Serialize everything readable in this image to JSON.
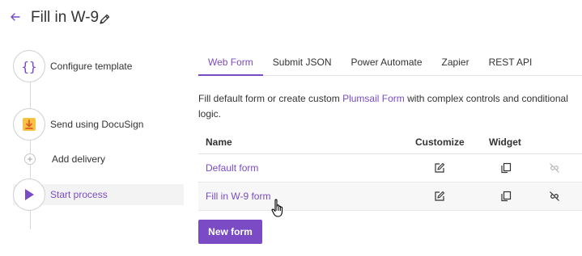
{
  "header": {
    "back_icon": "arrow-left-icon",
    "title": "Fill in W-9",
    "edit_icon": "pencil-icon"
  },
  "steps": [
    {
      "label": "Configure template",
      "icon": "braces-icon"
    },
    {
      "label": "Send using DocuSign",
      "icon": "download-icon"
    },
    {
      "label": "Add delivery",
      "icon": "plus-icon"
    },
    {
      "label": "Start process",
      "icon": "play-icon"
    }
  ],
  "tabs": [
    {
      "label": "Web Form",
      "active": true
    },
    {
      "label": "Submit JSON",
      "active": false
    },
    {
      "label": "Power Automate",
      "active": false
    },
    {
      "label": "Zapier",
      "active": false
    },
    {
      "label": "REST API",
      "active": false
    }
  ],
  "description": {
    "before_link": "Fill default form or create custom ",
    "link": "Plumsail Form",
    "after_link": " with complex controls and conditional logic."
  },
  "table": {
    "columns": {
      "name": "Name",
      "customize": "Customize",
      "widget": "Widget"
    },
    "rows": [
      {
        "name": "Default form",
        "customize_icon": "edit-icon",
        "widget_icon": "copy-icon",
        "unlink_icon": "unlink-icon",
        "unlink_enabled": false
      },
      {
        "name": "Fill in W-9 form",
        "customize_icon": "edit-icon",
        "widget_icon": "copy-icon",
        "unlink_icon": "unlink-icon",
        "unlink_enabled": true
      }
    ]
  },
  "new_form_button": "New form",
  "colors": {
    "accent": "#7a4bc4",
    "step_download": "#f5c242",
    "step_download_arrow": "#e05a2b"
  }
}
